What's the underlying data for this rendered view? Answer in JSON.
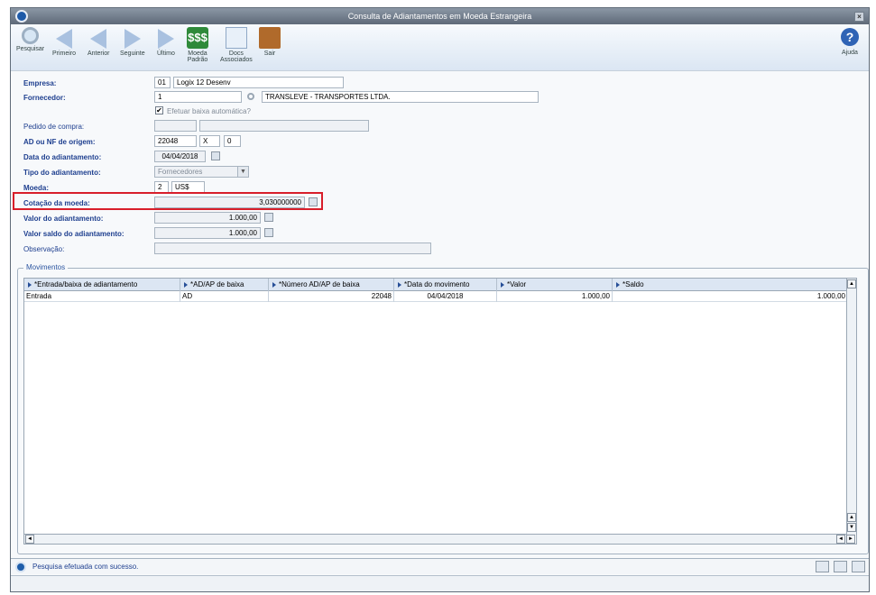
{
  "window": {
    "title": "Consulta de Adiantamentos em Moeda Estrangeira"
  },
  "toolbar": {
    "pesquisar": "Pesquisar",
    "primeiro": "Primeiro",
    "anterior": "Anterior",
    "seguinte": "Seguinte",
    "ultimo": "Último",
    "moeda_l1": "Moeda",
    "moeda_l2": "Padrão",
    "docs_l1": "Docs",
    "docs_l2": "Associados",
    "sair": "Sair",
    "ajuda": "Ajuda",
    "money_glyph": "$$$",
    "help_glyph": "?"
  },
  "form": {
    "empresa": {
      "label": "Empresa:",
      "code": "01",
      "name": "Logix 12 Desenv"
    },
    "fornecedor": {
      "label": "Fornecedor:",
      "code": "1",
      "name": "TRANSLEVE - TRANSPORTES LTDA."
    },
    "baixa_auto": {
      "label": "Efetuar baixa automática?",
      "checked": true,
      "check_glyph": "✔"
    },
    "pedido": {
      "label": "Pedido de compra:",
      "v1": "",
      "v2": ""
    },
    "ad_nf": {
      "label": "AD ou NF de origem:",
      "numero": "22048",
      "serie": "X",
      "seq": "0"
    },
    "data": {
      "label": "Data do adiantamento:",
      "value": "04/04/2018"
    },
    "tipo": {
      "label": "Tipo do adiantamento:",
      "value": "Fornecedores",
      "arrow": "▼"
    },
    "moeda": {
      "label": "Moeda:",
      "code": "2",
      "name": "US$"
    },
    "cotacao": {
      "label": "Cotação da moeda:",
      "value": "3,030000000"
    },
    "valor": {
      "label": "Valor do adiantamento:",
      "value": "1.000,00"
    },
    "saldo": {
      "label": "Valor saldo do adiantamento:",
      "value": "1.000,00"
    },
    "obs": {
      "label": "Observação:",
      "value": ""
    }
  },
  "movimentos": {
    "title": "Movimentos",
    "columns": [
      "*Entrada/baixa de adiantamento",
      "*AD/AP de baixa",
      "*Número AD/AP de baixa",
      "*Data do movimento",
      "*Valor",
      "*Saldo"
    ],
    "rows": [
      [
        "Entrada",
        "AD",
        "22048",
        "04/04/2018",
        "1.000,00",
        "1.000,00"
      ]
    ],
    "scroll_up": "▲",
    "scroll_down": "▼",
    "scroll_left": "◄",
    "scroll_right": "►"
  },
  "status": {
    "message": "Pesquisa efetuada com sucesso."
  },
  "colors": {
    "title_bar": "#6b7686",
    "label_blue": "#1e3f8f",
    "highlight_red": "#d81e2a"
  }
}
